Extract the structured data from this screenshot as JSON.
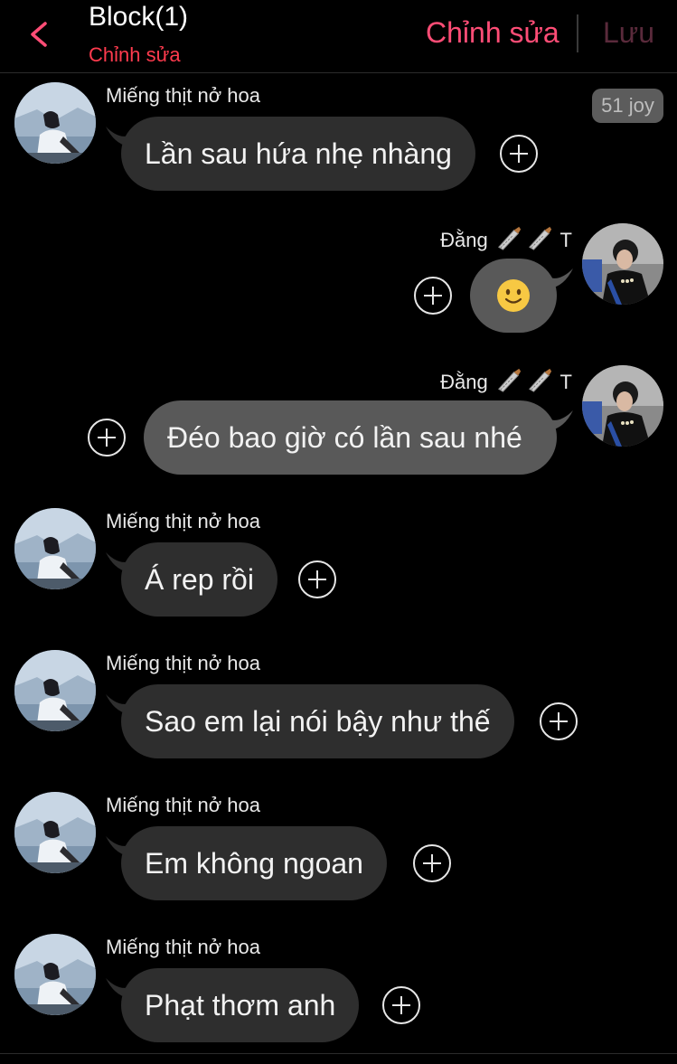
{
  "header": {
    "title": "Block(1)",
    "subtitle": "Chỉnh sửa",
    "edit_label": "Chỉnh sửa",
    "save_label": "Lưu"
  },
  "badge": {
    "joy": "51 joy"
  },
  "colors": {
    "accent_pink": "#ff4d76",
    "subtitle_red": "#ff3b4e",
    "bubble_incoming": "#2e2e2e",
    "bubble_outgoing": "#595959",
    "background": "#000000"
  },
  "messages": [
    {
      "sender": "Miếng thịt nở hoa",
      "text": "Lần sau hứa nhẹ nhàng",
      "side": "left"
    },
    {
      "sender": "Đằng",
      "sender_suffix": "T",
      "sender_icons": [
        "saw-icon",
        "saw-icon"
      ],
      "text": "",
      "emoji": "slightly-smiling-face",
      "side": "right"
    },
    {
      "sender": "Đằng",
      "sender_suffix": "T",
      "sender_icons": [
        "saw-icon",
        "saw-icon"
      ],
      "text": "Đéo bao giờ có lần sau nhé",
      "side": "right"
    },
    {
      "sender": "Miếng thịt nở hoa",
      "text": "Á rep rồi",
      "side": "left"
    },
    {
      "sender": "Miếng thịt nở hoa",
      "text": "Sao em lại nói bậy như thế",
      "side": "left"
    },
    {
      "sender": "Miếng thịt nở hoa",
      "text": "Em không ngoan",
      "side": "left"
    },
    {
      "sender": "Miếng thịt nở hoa",
      "text": "Phạt thơm anh",
      "side": "left"
    }
  ]
}
